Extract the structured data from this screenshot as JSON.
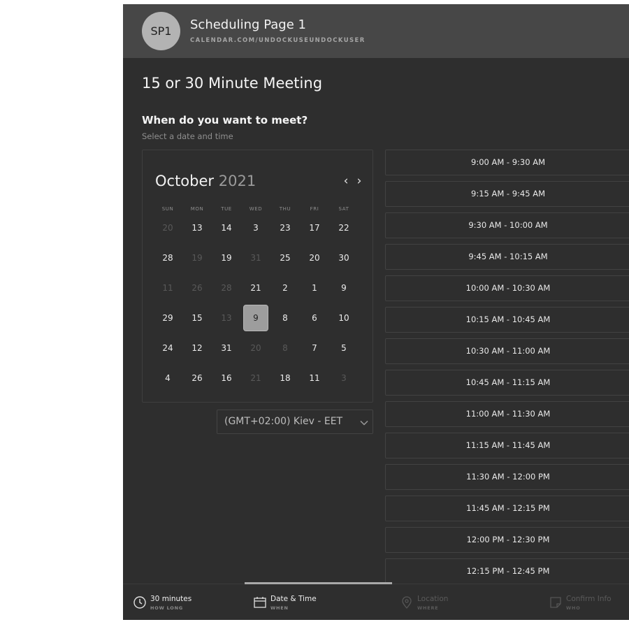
{
  "header": {
    "avatar_initials": "SP1",
    "title": "Scheduling Page 1",
    "url": "CALENDAR.COM/UNDOCKUSEUNDOCKUSER"
  },
  "meeting_title": "15 or 30 Minute Meeting",
  "question": {
    "title": "When do you want to meet?",
    "subtitle": "Select a date and time"
  },
  "calendar": {
    "month": "October",
    "year": "2021",
    "prev_icon": "chevron-left-icon",
    "next_icon": "chevron-right-icon",
    "weekdays": [
      "SUN",
      "MON",
      "TUE",
      "WED",
      "THU",
      "FRI",
      "SAT"
    ],
    "weeks": [
      [
        {
          "d": "20",
          "a": false
        },
        {
          "d": "13",
          "a": true
        },
        {
          "d": "14",
          "a": true
        },
        {
          "d": "3",
          "a": true
        },
        {
          "d": "23",
          "a": true
        },
        {
          "d": "17",
          "a": true
        },
        {
          "d": "22",
          "a": true
        }
      ],
      [
        {
          "d": "28",
          "a": true
        },
        {
          "d": "19",
          "a": false
        },
        {
          "d": "19",
          "a": true
        },
        {
          "d": "31",
          "a": false
        },
        {
          "d": "25",
          "a": true
        },
        {
          "d": "20",
          "a": true
        },
        {
          "d": "30",
          "a": true
        }
      ],
      [
        {
          "d": "11",
          "a": false
        },
        {
          "d": "26",
          "a": false
        },
        {
          "d": "28",
          "a": false
        },
        {
          "d": "21",
          "a": true
        },
        {
          "d": "2",
          "a": true
        },
        {
          "d": "1",
          "a": true
        },
        {
          "d": "9",
          "a": true
        }
      ],
      [
        {
          "d": "29",
          "a": true
        },
        {
          "d": "15",
          "a": true
        },
        {
          "d": "13",
          "a": false
        },
        {
          "d": "9",
          "a": true,
          "s": true
        },
        {
          "d": "8",
          "a": true
        },
        {
          "d": "6",
          "a": true
        },
        {
          "d": "10",
          "a": true
        }
      ],
      [
        {
          "d": "24",
          "a": true
        },
        {
          "d": "12",
          "a": true
        },
        {
          "d": "31",
          "a": true
        },
        {
          "d": "20",
          "a": false
        },
        {
          "d": "8",
          "a": false
        },
        {
          "d": "7",
          "a": true
        },
        {
          "d": "5",
          "a": true
        }
      ],
      [
        {
          "d": "4",
          "a": true
        },
        {
          "d": "26",
          "a": true
        },
        {
          "d": "16",
          "a": true
        },
        {
          "d": "21",
          "a": false
        },
        {
          "d": "18",
          "a": true
        },
        {
          "d": "11",
          "a": true
        },
        {
          "d": "3",
          "a": false
        }
      ]
    ]
  },
  "timezone": {
    "label": "(GMT+02:00) Kiev - EET",
    "icon": "chevron-down-icon"
  },
  "time_slots": [
    "9:00 AM - 9:30 AM",
    "9:15 AM - 9:45 AM",
    "9:30 AM - 10:00 AM",
    "9:45 AM - 10:15 AM",
    "10:00 AM - 10:30 AM",
    "10:15 AM - 10:45 AM",
    "10:30 AM - 11:00 AM",
    "10:45 AM - 11:15 AM",
    "11:00 AM - 11:30 AM",
    "11:15 AM - 11:45 AM",
    "11:30 AM - 12:00 PM",
    "11:45 AM - 12:15 PM",
    "12:00 PM - 12:30 PM",
    "12:15 PM - 12:45 PM"
  ],
  "steps": [
    {
      "label": "30 minutes",
      "sub": "HOW LONG",
      "icon": "clock-icon",
      "active": true
    },
    {
      "label": "Date & Time",
      "sub": "WHEN",
      "icon": "calendar-icon",
      "active": true
    },
    {
      "label": "Location",
      "sub": "WHERE",
      "icon": "location-pin-icon",
      "active": false
    },
    {
      "label": "Confirm Info",
      "sub": "WHO",
      "icon": "note-icon",
      "active": false
    }
  ],
  "colors": {
    "background": "#2e2e2e",
    "header": "#474747",
    "selected_day": "#9d9d9d",
    "slot_border": "#424242"
  }
}
